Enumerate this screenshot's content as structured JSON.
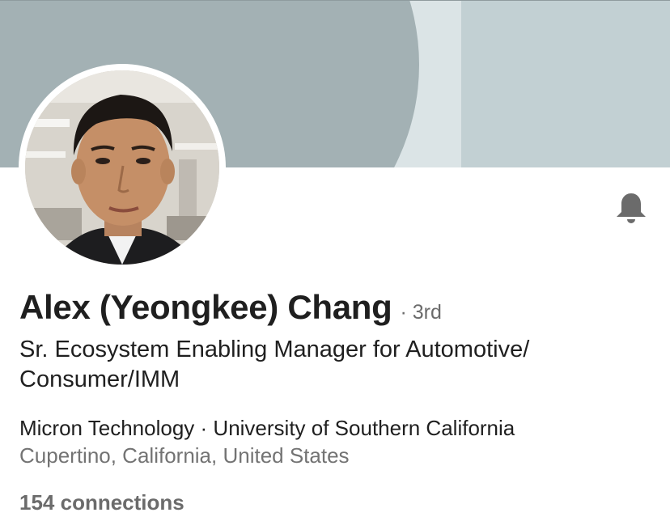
{
  "profile": {
    "name": "Alex (Yeongkee) Chang",
    "degree": "· 3rd",
    "headline": "Sr. Ecosystem Enabling Manager for Automotive/ Consumer/IMM",
    "company": "Micron Technology",
    "separator": " · ",
    "school": "University of Southern California",
    "location": "Cupertino, California, United States",
    "connections": "154 connections"
  },
  "icons": {
    "notify": "bell-icon"
  },
  "colors": {
    "banner_dark": "#a3b1b4",
    "banner_light": "#dbe4e6",
    "banner_right": "#c2d0d3",
    "text_primary": "#1f1f1f",
    "text_secondary": "#737373",
    "icon": "#6b6b6b"
  }
}
